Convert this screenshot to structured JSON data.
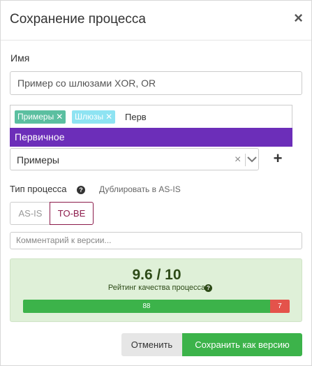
{
  "dialog": {
    "title": "Сохранение процесса",
    "close_symbol": "×"
  },
  "name_field": {
    "label": "Имя",
    "value": "Пример со шлюзами XOR, OR"
  },
  "tags": {
    "items": [
      {
        "label": "Примеры",
        "remove": "✕",
        "color": "#5bbfa0"
      },
      {
        "label": "Шлюзы",
        "remove": "✕",
        "color": "#8ee3f2"
      }
    ],
    "search_text": "Перв",
    "dropdown_option": "Первичное",
    "dropdown_highlight": "#6c2eb9"
  },
  "folder_select": {
    "value": "Примеры",
    "clear_symbol": "×",
    "add_symbol": "+"
  },
  "process_type": {
    "label": "Тип процесса",
    "help_symbol": "?",
    "duplicate_label": "Дублировать в AS-IS",
    "options": [
      "AS-IS",
      "TO-BE"
    ],
    "selected": "TO-BE"
  },
  "comment_field": {
    "placeholder": "Комментарий к версии..."
  },
  "rating": {
    "score": "9.6 / 10",
    "label": "Рейтинг качества процесса",
    "help_symbol": "?",
    "good_value": "88",
    "bad_value": "7",
    "good_color": "#3cb34a",
    "bad_color": "#e4534b"
  },
  "actions": {
    "cancel_label": "Отменить",
    "save_label": "Сохранить как версию"
  }
}
